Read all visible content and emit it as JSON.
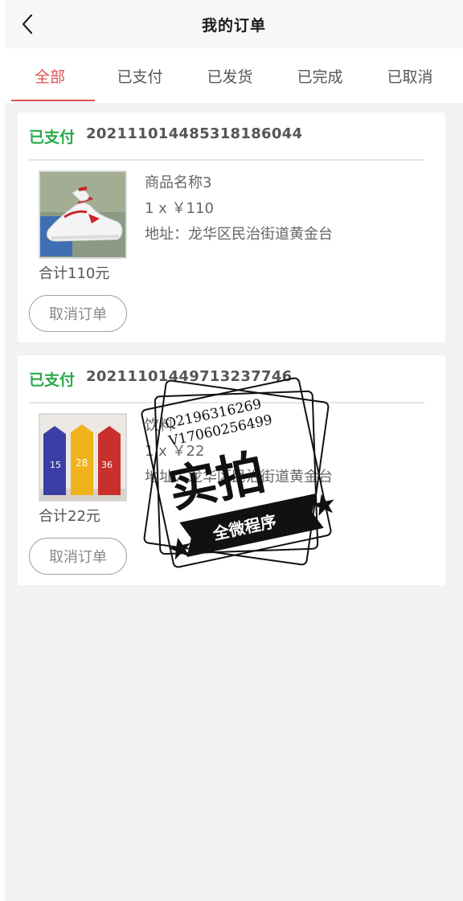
{
  "header": {
    "title": "我的订单",
    "back_icon": "chevron-left-icon"
  },
  "tabs": [
    {
      "label": "全部",
      "active": true
    },
    {
      "label": "已支付",
      "active": false
    },
    {
      "label": "已发货",
      "active": false
    },
    {
      "label": "已完成",
      "active": false
    },
    {
      "label": "已取消",
      "active": false
    }
  ],
  "orders": [
    {
      "status": "已支付",
      "order_no": "20211101448531818604​4",
      "product_name": "商品名称3",
      "qty_price": "1 x ￥110",
      "address": "地址：龙华区民治街道黄金台",
      "total": "合计110元",
      "cancel_label": "取消订单",
      "image": "sneaker-photo"
    },
    {
      "status": "已支付",
      "order_no": "20211101449713237746",
      "product_name": "饮料",
      "qty_price": "1 x ￥22",
      "address": "地址：龙华区民治街道黄金台",
      "total": "合计22元",
      "cancel_label": "取消订单",
      "image": "drink-cartons-photo"
    }
  ],
  "watermark": {
    "line1": "Q2196316269",
    "line2": "V17060256499",
    "big": "实拍",
    "ribbon": "全微程序"
  },
  "colors": {
    "active_tab": "#d9534f",
    "status_green": "#2ba84a",
    "background": "#f2f2f2"
  }
}
